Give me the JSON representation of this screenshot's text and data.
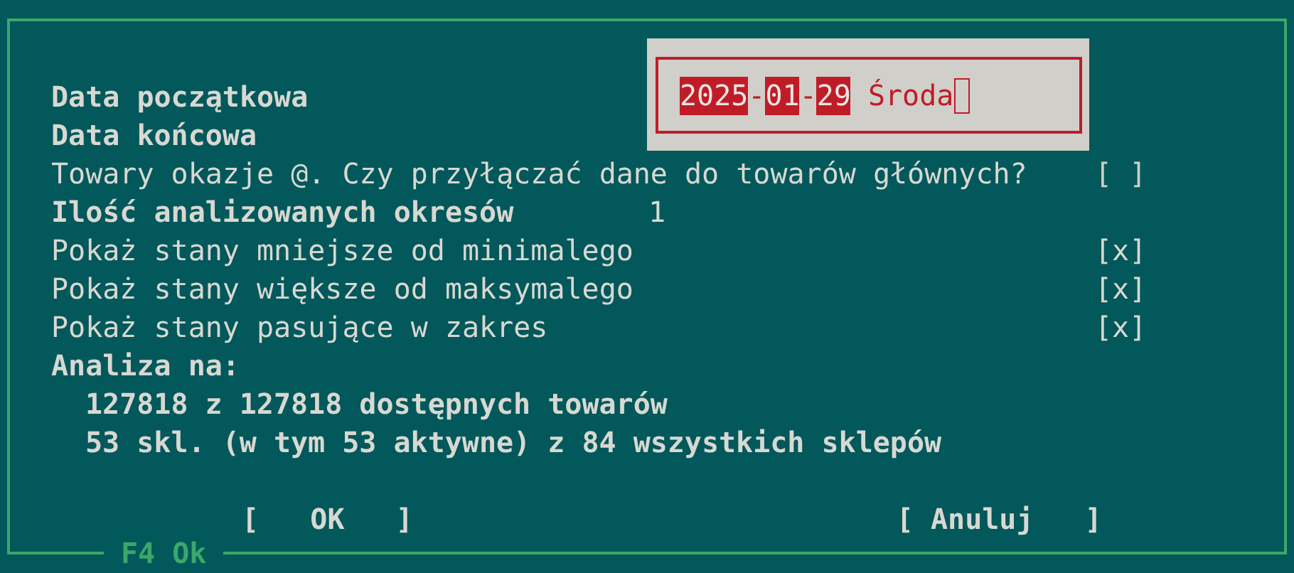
{
  "dialog": {
    "rows": [
      {
        "kind": "label",
        "label": "Data początkowa",
        "bold": true,
        "indented": false
      },
      {
        "kind": "label",
        "label": "Data końcowa",
        "bold": true,
        "indented": false
      },
      {
        "kind": "checkbox",
        "label": "Towary okazje @. Czy przyłączać dane do towarów głównych?",
        "bold": false,
        "indented": false,
        "box": "[ ]",
        "checked": false
      },
      {
        "kind": "value",
        "label": "Ilość analizowanych okresów",
        "bold": true,
        "indented": false,
        "value": "1"
      },
      {
        "kind": "checkbox",
        "label": "Pokaż stany mniejsze od minimalego",
        "bold": false,
        "indented": false,
        "box": "[x]",
        "checked": true
      },
      {
        "kind": "checkbox",
        "label": "Pokaż stany większe od maksymalego",
        "bold": false,
        "indented": false,
        "box": "[x]",
        "checked": true
      },
      {
        "kind": "checkbox",
        "label": "Pokaż stany pasujące w zakres",
        "bold": false,
        "indented": false,
        "box": "[x]",
        "checked": true
      },
      {
        "kind": "label",
        "label": "Analiza na:",
        "bold": true,
        "indented": false
      },
      {
        "kind": "label",
        "label": "127818 z 127818 dostępnych towarów",
        "bold": true,
        "indented": true
      },
      {
        "kind": "label",
        "label": "53 skl. (w tym 53 aktywne) z 84 wszystkich sklepów",
        "bold": true,
        "indented": true
      }
    ],
    "buttons": [
      "[   OK   ]",
      "[ Anuluj   ]"
    ],
    "footer": "F4 Ok"
  },
  "date_editor": {
    "segments": [
      {
        "text": "2025",
        "highlighted": true
      },
      {
        "text": "-",
        "highlighted": false
      },
      {
        "text": "01",
        "highlighted": true
      },
      {
        "text": "-",
        "highlighted": false
      },
      {
        "text": "29",
        "highlighted": true
      }
    ],
    "weekday": "Środa"
  }
}
